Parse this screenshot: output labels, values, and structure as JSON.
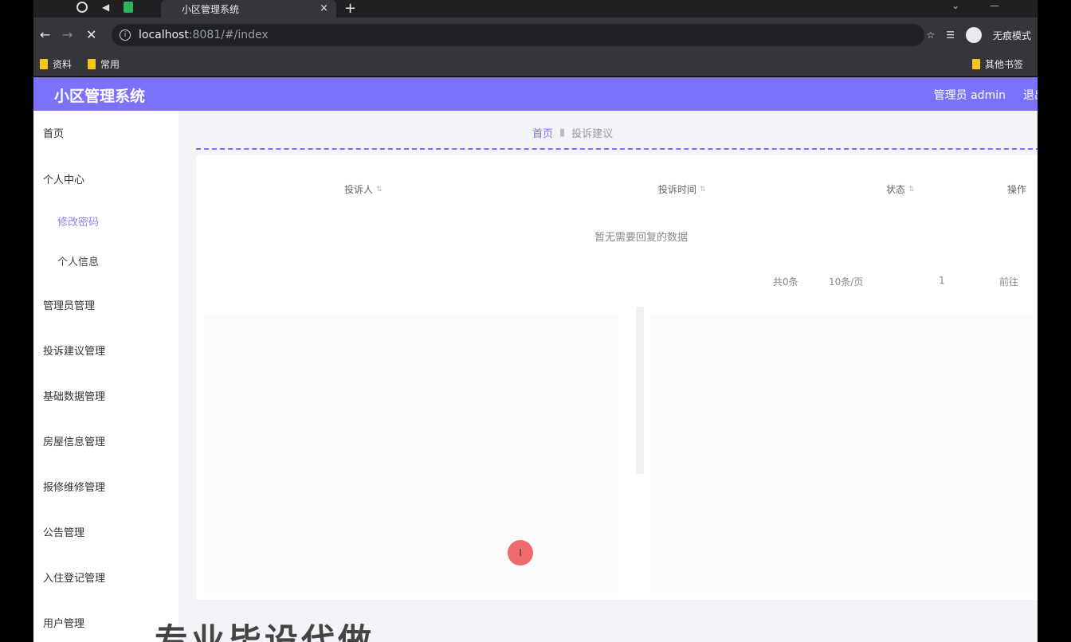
{
  "browser": {
    "tab_title": "小区管理系统",
    "tab_close": "×",
    "new_tab": "+",
    "url_host": "localhost",
    "url_rest": ":8081/#/index",
    "incognito_label": "无痕模式",
    "bookmarks": [
      "资料",
      "常用"
    ],
    "other_bookmarks": "其他书签"
  },
  "app": {
    "title": "小区管理系统",
    "user": "管理员 admin",
    "logout": "退出"
  },
  "sidebar": {
    "items": [
      {
        "label": "首页"
      },
      {
        "label": "个人中心"
      },
      {
        "label": "修改密码"
      },
      {
        "label": "个人信息"
      },
      {
        "label": "管理员管理"
      },
      {
        "label": "投诉建议管理"
      },
      {
        "label": "基础数据管理"
      },
      {
        "label": "房屋信息管理"
      },
      {
        "label": "报修维修管理"
      },
      {
        "label": "公告管理"
      },
      {
        "label": "入住登记管理"
      },
      {
        "label": "用户管理"
      }
    ]
  },
  "breadcrumb": {
    "home": "首页",
    "current": "投诉建议"
  },
  "table": {
    "columns": [
      "投诉人",
      "投诉时间",
      "状态",
      "操作"
    ],
    "empty": "暂无需要回复的数据"
  },
  "pager": {
    "total": "共0条",
    "page_size": "10条/页",
    "page": "1",
    "goto": "前往"
  },
  "overlay": {
    "text": "专业毕设代做"
  },
  "colors": {
    "accent": "#7c71f9",
    "cursor": "#ef6b6b"
  }
}
